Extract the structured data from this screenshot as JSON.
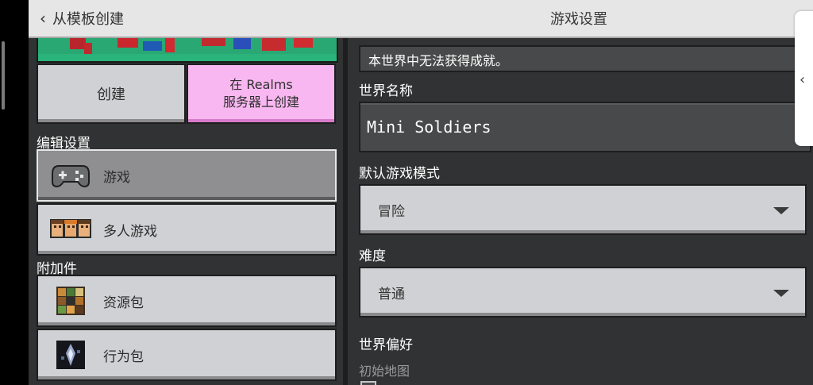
{
  "header": {
    "back_label": "从模板创建",
    "back_icon": "chevron-left-icon",
    "title": "游戏设置"
  },
  "left": {
    "buttons": {
      "create": "创建",
      "realms_line1": "在 Realms",
      "realms_line2": "服务器上创建"
    },
    "sections": {
      "edit": "编辑设置",
      "addons": "附加件"
    },
    "nav": [
      {
        "label": "游戏",
        "icon": "controller-icon",
        "selected": true
      },
      {
        "label": "多人游戏",
        "icon": "multiplayer-icon",
        "selected": false
      },
      {
        "label": "资源包",
        "icon": "resource-pack-icon",
        "selected": false
      },
      {
        "label": "行为包",
        "icon": "behavior-pack-icon",
        "selected": false
      }
    ]
  },
  "right": {
    "notice": "本世界中无法获得成就。",
    "world_name_label": "世界名称",
    "world_name_value": "Mini Soldiers",
    "game_mode_label": "默认游戏模式",
    "game_mode_value": "冒险",
    "difficulty_label": "难度",
    "difficulty_value": "普通",
    "world_prefs_label": "世界偏好",
    "starting_map_label": "初始地图"
  },
  "side_tab_icon": "chevron-left-icon",
  "colors": {
    "panel_bg": "#313233",
    "button_gray": "#d0d1d4",
    "button_pink": "#f8b7f0",
    "topbar": "#e6e6e6"
  }
}
